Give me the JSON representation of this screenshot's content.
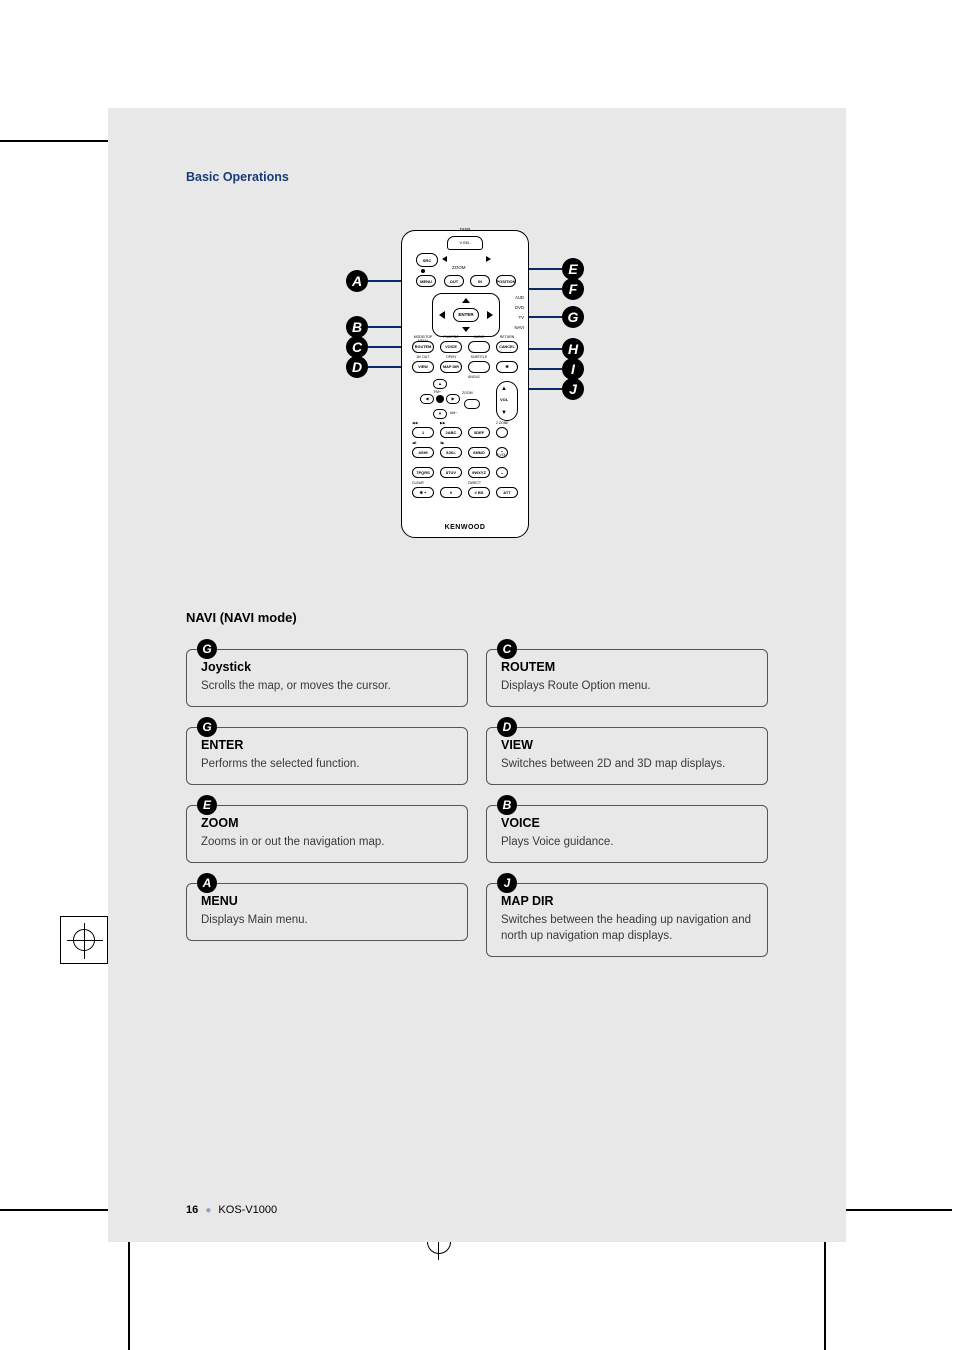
{
  "section": "Basic Operations",
  "mode_title": "NAVI (NAVI mode)",
  "page_number": "16",
  "model": "KOS-V1000",
  "remote": {
    "brand": "KENWOOD",
    "top": "V.SEL",
    "disp_lbl": "DISP",
    "src": "SRC",
    "zoom_lbl": "ZOOM",
    "menu": "MENU",
    "out": "OUT",
    "in": "IN",
    "position": "POSITION",
    "enter": "ENTER",
    "side_aud": "AUD",
    "side_dvd": "DVD",
    "side_tv": "TV",
    "side_navi": "NAVI",
    "row1": {
      "l1": "MODE/TOP MENU",
      "l2": "FNC/PBC",
      "l3": "AUDIO",
      "l4": "RETURN",
      "b1": "ROUTEM",
      "b2": "VOICE",
      "b3": "",
      "b4": "CANCEL"
    },
    "row2": {
      "l1": "AV OUT",
      "l2": "OPEN",
      "l3": "SUBTITLE",
      "l4": "",
      "b1": "VIEW",
      "b2": "MAP DIR",
      "b3": "",
      "b4": ""
    },
    "angle_lbl": "ANGLE",
    "fm_lbl": "FM+",
    "am_lbl": "AM−",
    "zoom2_lbl": "ZOOM",
    "vol": "VOL",
    "zone2_lbl": "2 ZONE",
    "rvol_lbl": "R.VOL",
    "clear_lbl": "CLEAR",
    "direct_lbl": "DIRECT",
    "num": {
      "1": "1",
      "2": "2ABC",
      "3": "3DEF",
      "4": "4GHI",
      "5": "5JKL",
      "6": "6MNO",
      "7": "7PQRS",
      "8": "8TUV",
      "9": "9WXYZ",
      "0": "0",
      "star": "✱ +",
      "hash": "# BS",
      "att": "ATT"
    }
  },
  "callouts": {
    "left": {
      "A": "A",
      "B": "B",
      "C": "C",
      "D": "D"
    },
    "right": {
      "E": "E",
      "F": "F",
      "G": "G",
      "H": "H",
      "I": "I",
      "J": "J"
    }
  },
  "boxes": {
    "left": [
      {
        "tag": "G",
        "title": "Joystick",
        "desc": "Scrolls the map, or moves the cursor."
      },
      {
        "tag": "G",
        "title": "ENTER",
        "desc": "Performs the selected function."
      },
      {
        "tag": "E",
        "title": "ZOOM",
        "desc": "Zooms in or out the navigation map."
      },
      {
        "tag": "A",
        "title": "MENU",
        "desc": "Displays Main menu."
      }
    ],
    "right": [
      {
        "tag": "C",
        "title": "ROUTEM",
        "desc": "Displays Route Option menu."
      },
      {
        "tag": "D",
        "title": "VIEW",
        "desc": "Switches between 2D and 3D map displays."
      },
      {
        "tag": "B",
        "title": "VOICE",
        "desc": "Plays Voice guidance."
      },
      {
        "tag": "J",
        "title": "MAP DIR",
        "desc": "Switches between the heading up navigation and north up navigation map displays."
      }
    ]
  }
}
